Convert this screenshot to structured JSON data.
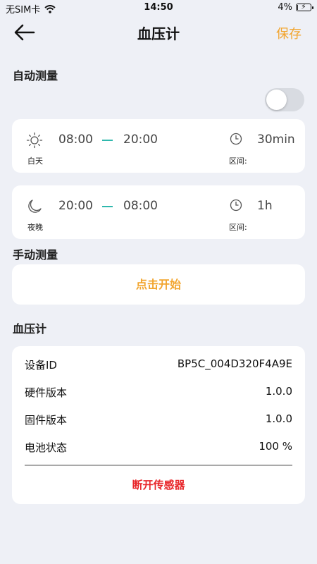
{
  "status_bar": {
    "carrier": "无SIM卡",
    "time": "14:50",
    "battery_text": "4%",
    "battery_level": 0.04
  },
  "nav": {
    "title": "血压计",
    "save_label": "保存"
  },
  "auto_measure": {
    "label": "自动测量",
    "toggle_on": false,
    "day": {
      "caption": "白天",
      "start": "08:00",
      "end": "20:00",
      "interval_label": "区间:",
      "interval_value": "30min"
    },
    "night": {
      "caption": "夜晚",
      "start": "20:00",
      "end": "08:00",
      "interval_label": "区间:",
      "interval_value": "1h"
    }
  },
  "manual_measure": {
    "label": "手动测量",
    "button_label": "点击开始"
  },
  "device": {
    "label": "血压计",
    "rows": [
      {
        "key": "设备ID",
        "value": "BP5C_004D320F4A9E"
      },
      {
        "key": "硬件版本",
        "value": "1.0.0"
      },
      {
        "key": "固件版本",
        "value": "1.0.0"
      },
      {
        "key": "电池状态",
        "value": "100 %"
      }
    ],
    "disconnect_label": "断开传感器"
  },
  "colors": {
    "accent": "#f2a52e",
    "danger": "#e8262a",
    "teal": "#2fb8ad",
    "background": "#eef0f6"
  },
  "icons": [
    "wifi-icon",
    "battery-icon",
    "back-arrow-icon",
    "sun-icon",
    "moon-icon",
    "clock-icon"
  ]
}
